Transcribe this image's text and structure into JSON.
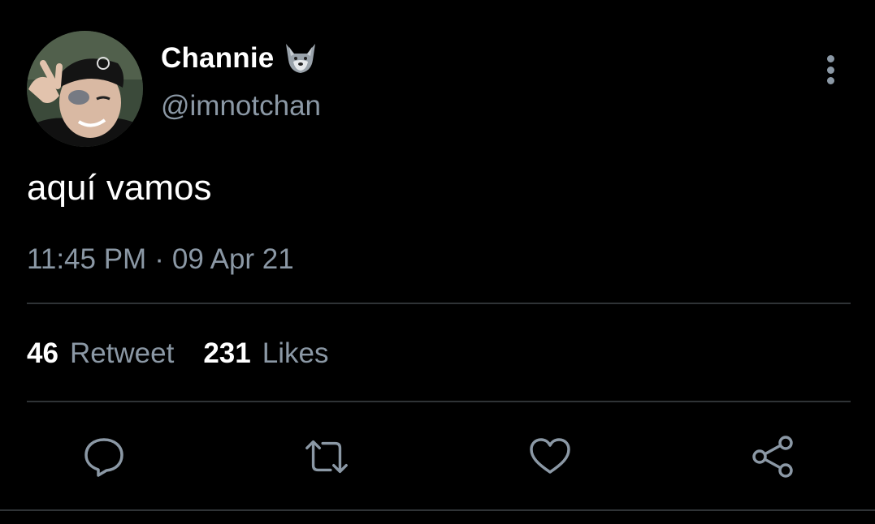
{
  "author": {
    "display_name": "Channie",
    "name_emoji": "wolf-face-emoji",
    "handle": "@imnotchan",
    "avatar": "profile-photo"
  },
  "tweet": {
    "text": "aquí vamos",
    "time": "11:45 PM",
    "separator": "·",
    "date": "09 Apr 21"
  },
  "stats": {
    "retweets_count": "46",
    "retweets_label": "Retweet",
    "likes_count": "231",
    "likes_label": "Likes"
  },
  "actions": {
    "reply_icon": "reply-icon",
    "retweet_icon": "retweet-icon",
    "like_icon": "like-icon",
    "share_icon": "share-icon",
    "more_icon": "more-vertical-icon"
  },
  "colors": {
    "background": "#000000",
    "text_primary": "#ffffff",
    "text_secondary": "#8b98a5",
    "divider": "#2f3336"
  }
}
